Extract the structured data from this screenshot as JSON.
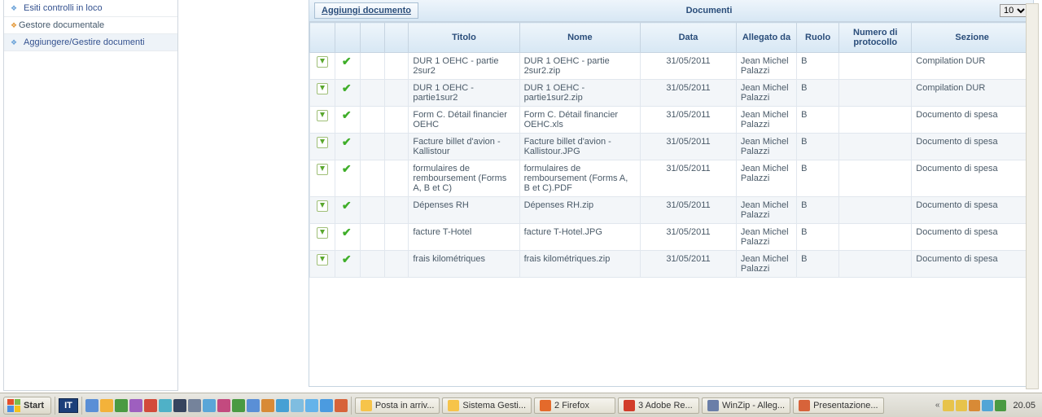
{
  "sidebar": {
    "items": [
      {
        "label": "Esiti controlli in loco",
        "bullet": "blue",
        "level": 2
      },
      {
        "label": "Gestore documentale",
        "bullet": "orange",
        "level": 1
      },
      {
        "label": "Aggiungere/Gestire documenti",
        "bullet": "blue",
        "level": 2,
        "active": true
      }
    ]
  },
  "docpanel": {
    "add_label": "Aggiungi documento",
    "title": "Documenti",
    "page_size": "10"
  },
  "columns": {
    "titolo": "Titolo",
    "nome": "Nome",
    "data": "Data",
    "allegato": "Allegato da",
    "ruolo": "Ruolo",
    "protocollo": "Numero di protocollo",
    "sezione": "Sezione"
  },
  "rows": [
    {
      "titolo": "DUR 1 OEHC - partie 2sur2",
      "nome": "DUR 1 OEHC - partie 2sur2.zip",
      "data": "31/05/2011",
      "allegato": "Jean Michel Palazzi",
      "ruolo": "B",
      "protocollo": "",
      "sezione": "Compilation DUR"
    },
    {
      "titolo": "DUR 1 OEHC - partie1sur2",
      "nome": "DUR 1 OEHC - partie1sur2.zip",
      "data": "31/05/2011",
      "allegato": "Jean Michel Palazzi",
      "ruolo": "B",
      "protocollo": "",
      "sezione": "Compilation DUR"
    },
    {
      "titolo": "Form C. Détail financier OEHC",
      "nome": "Form C. Détail financier OEHC.xls",
      "data": "31/05/2011",
      "allegato": "Jean Michel Palazzi",
      "ruolo": "B",
      "protocollo": "",
      "sezione": "Documento di spesa"
    },
    {
      "titolo": "Facture billet d'avion - Kallistour",
      "nome": "Facture billet d'avion - Kallistour.JPG",
      "data": "31/05/2011",
      "allegato": "Jean Michel Palazzi",
      "ruolo": "B",
      "protocollo": "",
      "sezione": "Documento di spesa"
    },
    {
      "titolo": "formulaires de remboursement (Forms A, B et C)",
      "nome": "formulaires de remboursement (Forms A, B et C).PDF",
      "data": "31/05/2011",
      "allegato": "Jean Michel Palazzi",
      "ruolo": "B",
      "protocollo": "",
      "sezione": "Documento di spesa"
    },
    {
      "titolo": "Dépenses RH",
      "nome": "Dépenses RH.zip",
      "data": "31/05/2011",
      "allegato": "Jean Michel Palazzi",
      "ruolo": "B",
      "protocollo": "",
      "sezione": "Documento di spesa"
    },
    {
      "titolo": "facture T-Hotel",
      "nome": "facture T-Hotel.JPG",
      "data": "31/05/2011",
      "allegato": "Jean Michel Palazzi",
      "ruolo": "B",
      "protocollo": "",
      "sezione": "Documento di spesa"
    },
    {
      "titolo": "frais kilométriques",
      "nome": "frais kilométriques.zip",
      "data": "31/05/2011",
      "allegato": "Jean Michel Palazzi",
      "ruolo": "B",
      "protocollo": "",
      "sezione": "Documento di spesa"
    }
  ],
  "taskbar": {
    "start": "Start",
    "lang": "IT",
    "items": [
      {
        "label": "Posta in arriv...",
        "color": "#f6c44a"
      },
      {
        "label": "Sistema Gesti...",
        "color": "#f6c44a"
      },
      {
        "label": "2 Firefox",
        "color": "#e46a2b"
      },
      {
        "label": "3 Adobe Re...",
        "color": "#d23c2a"
      },
      {
        "label": "WinZip - Alleg...",
        "color": "#6a7ea8"
      },
      {
        "label": "Presentazione...",
        "color": "#d7633a"
      }
    ],
    "ql_colors": [
      "#5a8fd6",
      "#f3b23a",
      "#4a9a42",
      "#9e5fbf",
      "#d24a3a",
      "#4fb1c7",
      "#36445e",
      "#75839b",
      "#5aa6d8",
      "#c34a7f",
      "#4a9a42",
      "#5a8fd6",
      "#d88a36",
      "#46a0d4",
      "#7fbde0",
      "#64b3ea",
      "#4b9be0",
      "#d7633a"
    ],
    "tray_colors": [
      "#e7c34b",
      "#e7c34b",
      "#d88a36",
      "#52a5d6",
      "#4a9a42"
    ],
    "clock": "20.05"
  }
}
